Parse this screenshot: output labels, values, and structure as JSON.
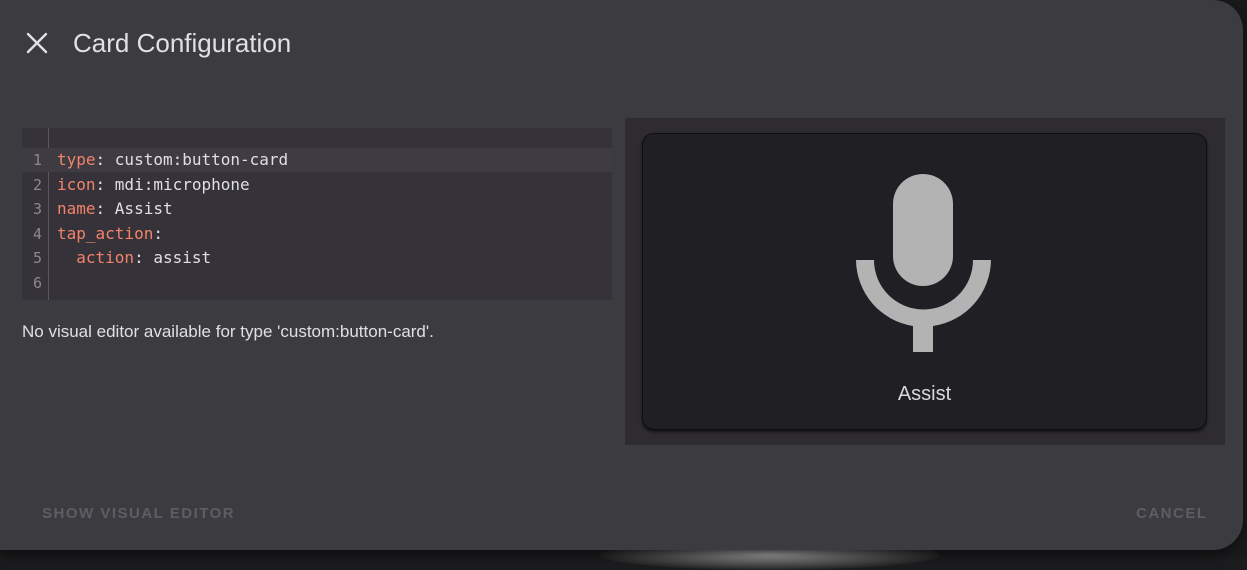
{
  "dialog": {
    "title": "Card Configuration",
    "close_icon": "close-icon"
  },
  "editor": {
    "lines": [
      {
        "num": "1",
        "key": "type",
        "sep": ": ",
        "value": "custom:button-card"
      },
      {
        "num": "2",
        "key": "icon",
        "sep": ": ",
        "value": "mdi:microphone"
      },
      {
        "num": "3",
        "key": "name",
        "sep": ": ",
        "value": "Assist"
      },
      {
        "num": "4",
        "key": "tap_action",
        "sep": ":",
        "value": ""
      },
      {
        "num": "5",
        "indent": "  ",
        "key": "action",
        "sep": ": ",
        "value": "assist"
      },
      {
        "num": "6",
        "key": "",
        "sep": "",
        "value": ""
      }
    ],
    "note": "No visual editor available for type 'custom:button-card'."
  },
  "preview": {
    "card_icon": "microphone-icon",
    "card_name": "Assist"
  },
  "footer": {
    "show_visual_editor": "SHOW VISUAL EDITOR",
    "cancel": "CANCEL"
  },
  "colors": {
    "dialog_bg": "#3c3b40",
    "yaml_key": "#f2836b",
    "icon": "#b3b3b3"
  }
}
